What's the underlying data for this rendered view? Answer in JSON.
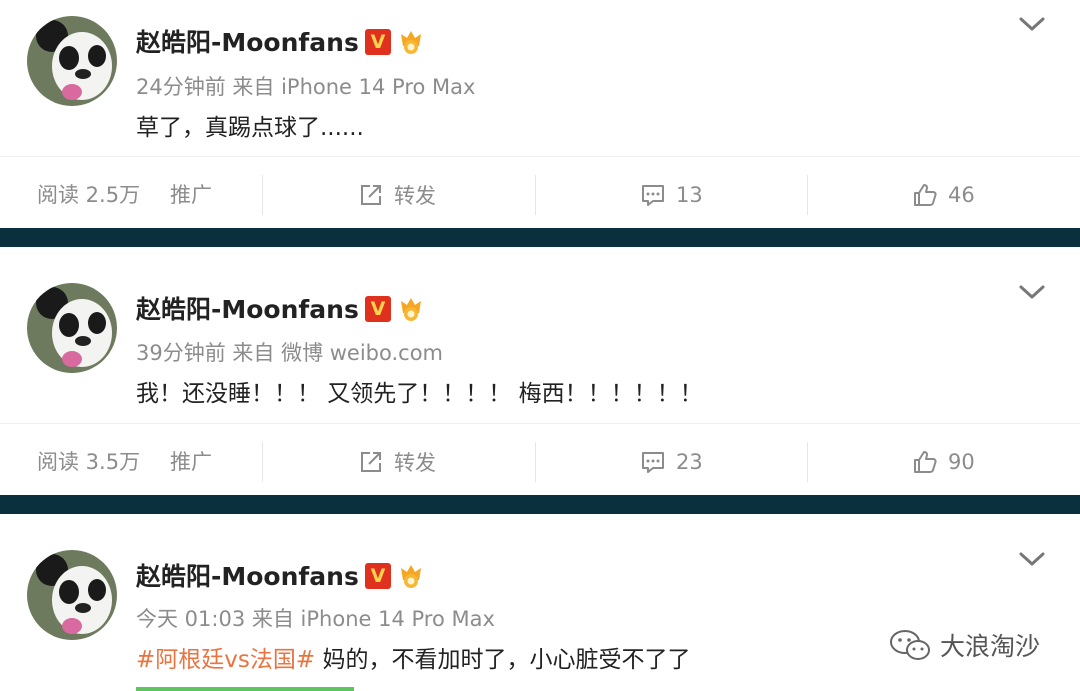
{
  "posts": [
    {
      "author": "赵皓阳-Moonfans",
      "vip_badge": "V",
      "meta": "24分钟前 来自 iPhone 14 Pro Max",
      "text": "草了，真踢点球了......",
      "reads": "阅读 2.5万",
      "promote": "推广",
      "repost": "转发",
      "comments": "13",
      "likes": "46"
    },
    {
      "author": "赵皓阳-Moonfans",
      "vip_badge": "V",
      "meta": "39分钟前 来自 微博 weibo.com",
      "text": "我！还没睡！！！ 又领先了！！！！ 梅西！！！！！！",
      "reads": "阅读 3.5万",
      "promote": "推广",
      "repost": "转发",
      "comments": "23",
      "likes": "90"
    },
    {
      "author": "赵皓阳-Moonfans",
      "vip_badge": "V",
      "meta": "今天 01:03 来自 iPhone 14 Pro Max",
      "hashtag": "#阿根廷vs法国#",
      "text": " 妈的，不看加时了，小心脏受不了了"
    }
  ],
  "watermark": "大浪淘沙",
  "icons": {
    "avatar": "panda-avatar-icon",
    "medal": "medal-icon",
    "menu": "chevron-down-icon",
    "repost": "repost-icon",
    "comment": "comment-icon",
    "like": "thumbs-up-icon",
    "watermark": "wechat-icon"
  },
  "colors": {
    "separator": "#0a2f3d",
    "hashtag": "#eb7340",
    "vip_badge": "#e0301e",
    "meta_text": "#8c8c8c"
  }
}
